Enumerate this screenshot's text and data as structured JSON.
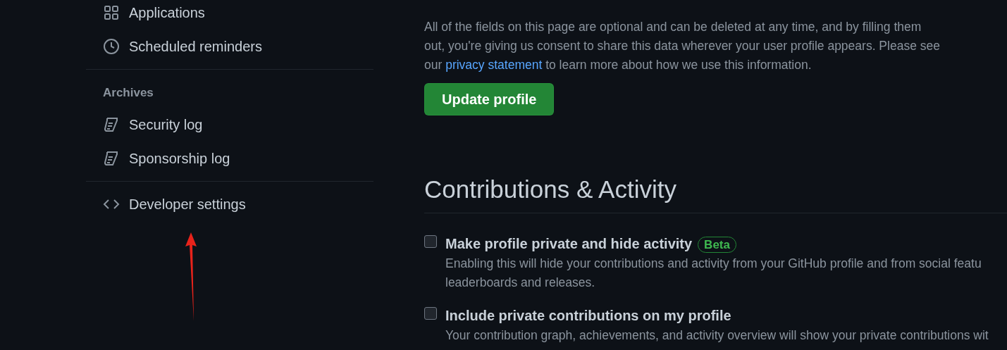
{
  "sidebar": {
    "groups": [
      {
        "items": [
          {
            "label": "Applications",
            "kind": "grid"
          },
          {
            "label": "Scheduled reminders",
            "kind": "clock"
          }
        ]
      },
      {
        "heading": "Archives",
        "items": [
          {
            "label": "Security log",
            "kind": "log"
          },
          {
            "label": "Sponsorship log",
            "kind": "log"
          }
        ]
      },
      {
        "items": [
          {
            "label": "Developer settings",
            "kind": "code"
          }
        ]
      }
    ]
  },
  "main": {
    "notice": {
      "before": "All of the fields on this page are optional and can be deleted at any time, and by filling them out, you're giving us consent to share this data wherever your user profile appears. Please see our",
      "link": "privacy statement",
      "after": "to learn more about how we use this information."
    },
    "button": "Update profile",
    "section_title": "Contributions & Activity",
    "options": [
      {
        "label": "Make profile private and hide activity",
        "badge": "Beta",
        "checked": false,
        "description": "Enabling this will hide your contributions and activity from your GitHub profile and from social featu",
        "description_2": "leaderboards and releases."
      },
      {
        "label": "Include private contributions on my profile",
        "checked": false,
        "description": "Your contribution graph, achievements, and activity overview will show your private contributions wit"
      }
    ]
  },
  "annotation": {
    "kind": "arrow"
  }
}
